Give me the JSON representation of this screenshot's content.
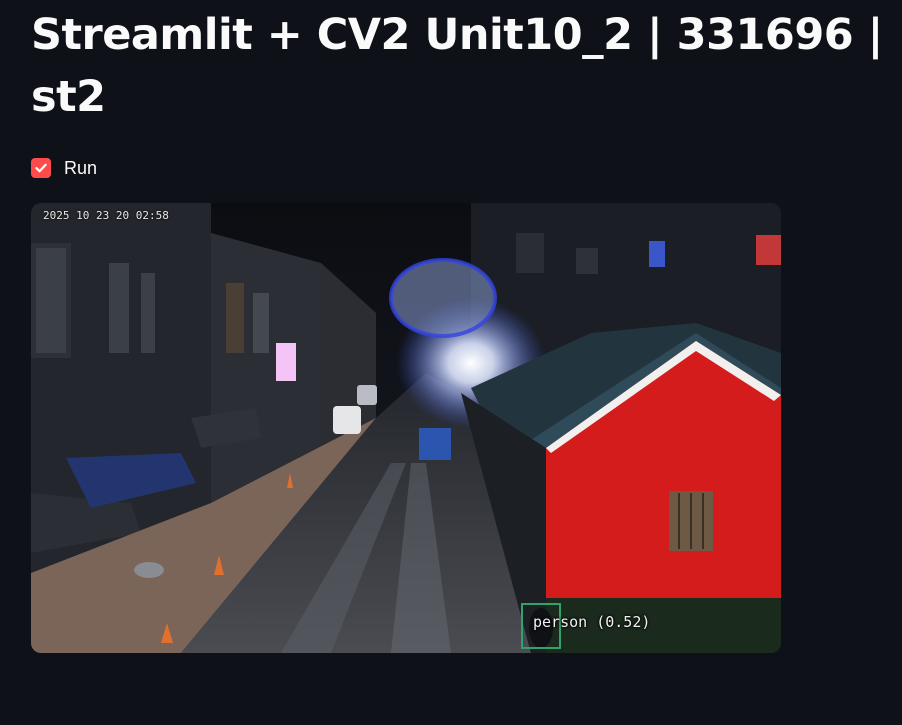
{
  "page": {
    "title": "Streamlit + CV2 Unit10_2 | 331696 | st2"
  },
  "controls": {
    "run_checkbox": {
      "label": "Run",
      "checked": true,
      "color": "#ff4b4b"
    }
  },
  "video": {
    "timestamp": "2025 10 23 20 02:58",
    "detection": {
      "label": "person (0.52)",
      "box_color": "#2fa36b"
    }
  },
  "theme": {
    "background": "#0e1117",
    "text": "#fafafa",
    "accent": "#ff4b4b"
  }
}
